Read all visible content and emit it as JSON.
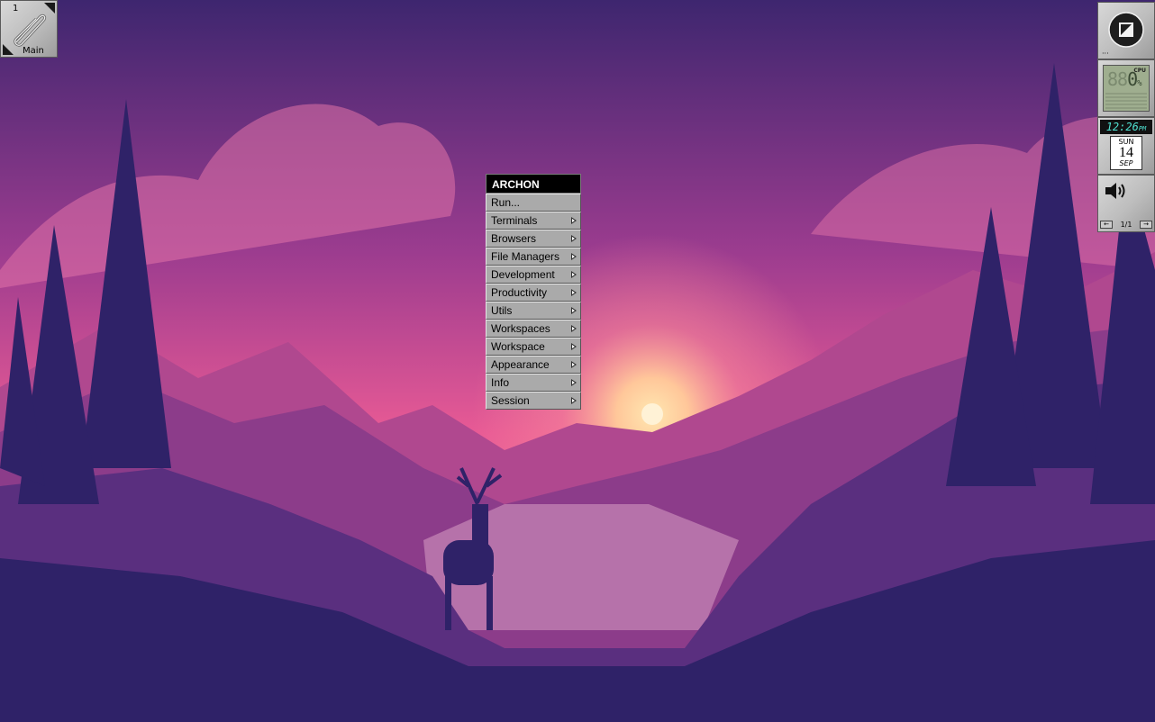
{
  "workspace_clip": {
    "number": "1",
    "name": "Main"
  },
  "dock": {
    "logo_icon": "windowmaker-logo-icon",
    "cpu": {
      "label": "CPU",
      "value": "0",
      "unit": "%"
    },
    "clock": {
      "hours": "12",
      "minutes": "26",
      "ampm": "PM",
      "weekday": "SUN",
      "day": "14",
      "month": "SEP"
    },
    "volume": {
      "icon": "speaker-icon",
      "page": "1/1"
    }
  },
  "menu": {
    "title": "ARCHON",
    "items": [
      {
        "label": "Run...",
        "submenu": false
      },
      {
        "label": "Terminals",
        "submenu": true
      },
      {
        "label": "Browsers",
        "submenu": true
      },
      {
        "label": "File Managers",
        "submenu": true
      },
      {
        "label": "Development",
        "submenu": true
      },
      {
        "label": "Productivity",
        "submenu": true
      },
      {
        "label": "Utils",
        "submenu": true
      },
      {
        "label": "Workspaces",
        "submenu": true
      },
      {
        "label": "Workspace",
        "submenu": true
      },
      {
        "label": "Appearance",
        "submenu": true
      },
      {
        "label": "Info",
        "submenu": true
      },
      {
        "label": "Session",
        "submenu": true
      }
    ]
  },
  "colors": {
    "menu_title_bg": "#000000",
    "menu_item_bg": "#aaaaaa",
    "sky_top": "#3f2770",
    "sky_glow": "#f45a9a",
    "foreground": "#2f2268"
  }
}
